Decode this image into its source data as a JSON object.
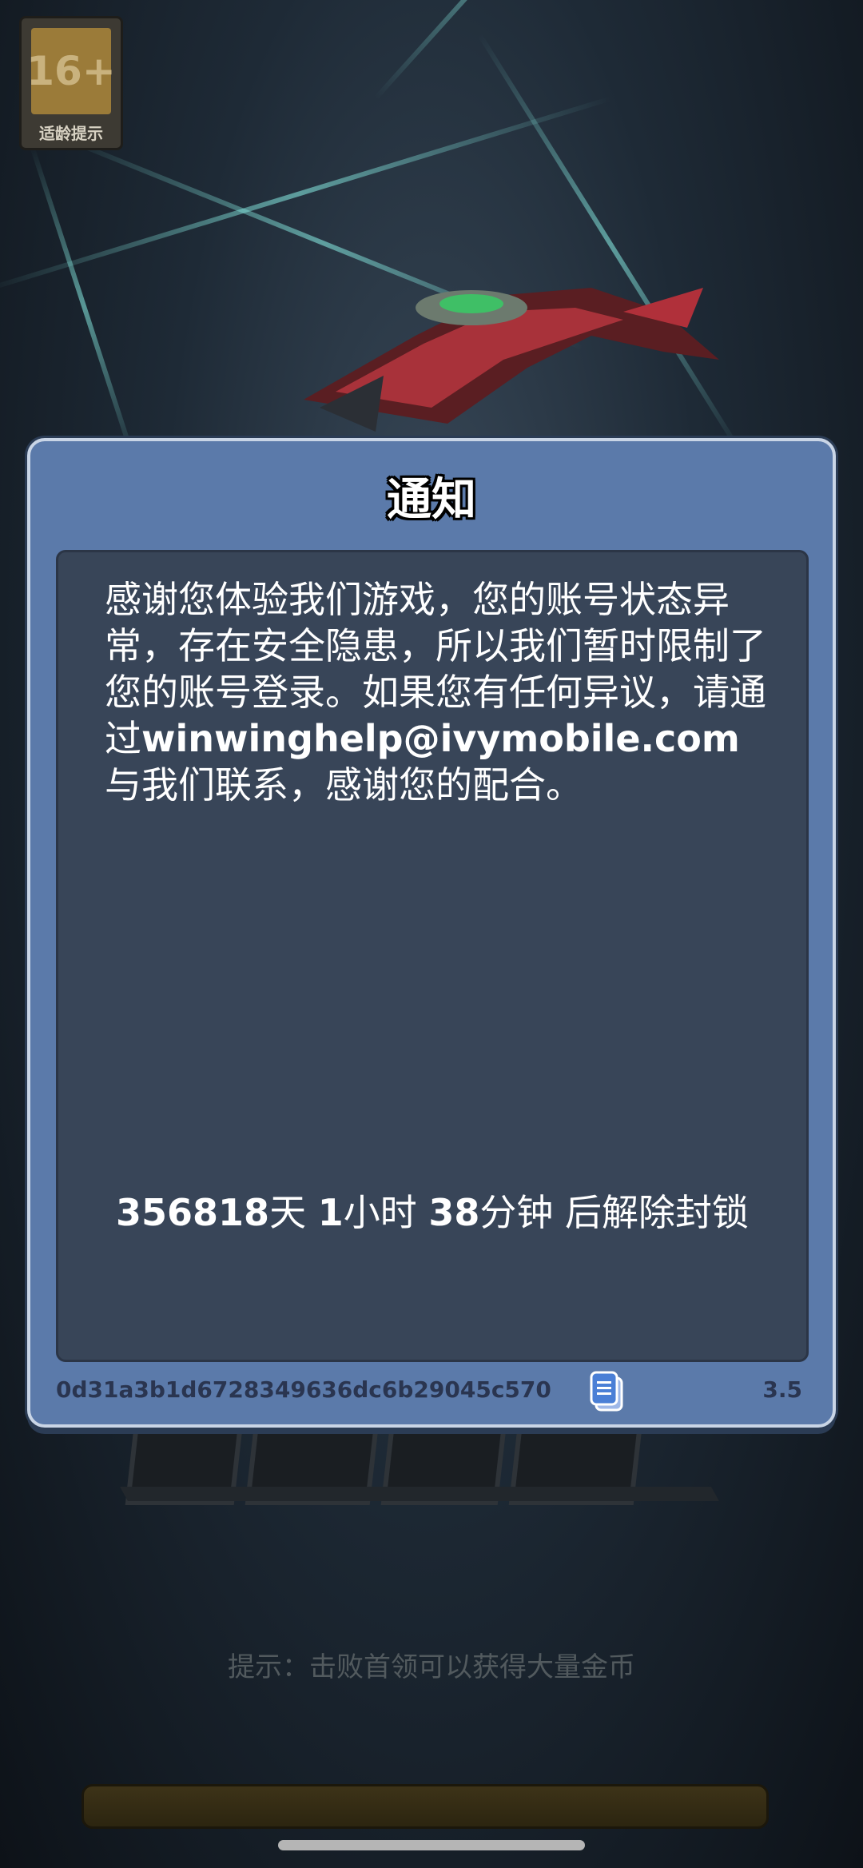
{
  "rating_badge": {
    "age": "16+",
    "caption": "适龄提示"
  },
  "dialog": {
    "title": "通知",
    "message_parts": {
      "before_email": "感谢您体验我们游戏，您的账号状态异常，存在安全隐患，所以我们暂时限制了您的账号登录。如果您有任何异议，请通过",
      "email": "winwinghelp@ivymobile.com",
      "after_email": "与我们联系，感谢您的配合。"
    },
    "countdown": {
      "days": "356818",
      "days_unit": "天",
      "hours": "1",
      "hours_unit": "小时",
      "minutes": "38",
      "minutes_unit": "分钟",
      "suffix": "后解除封锁"
    },
    "device_id": "0d31a3b1d6728349636dc6b29045c570",
    "copy_icon": "copy-document-icon",
    "version": "3.5"
  },
  "background": {
    "hint": "提示：击败首领可以获得大量金币"
  },
  "colors": {
    "dialog_bg": "#5b7aaa",
    "dialog_border": "#c9d5e6",
    "body_bg": "#384558",
    "footer_text": "#2a3550",
    "badge_gold": "#9b7b39"
  }
}
